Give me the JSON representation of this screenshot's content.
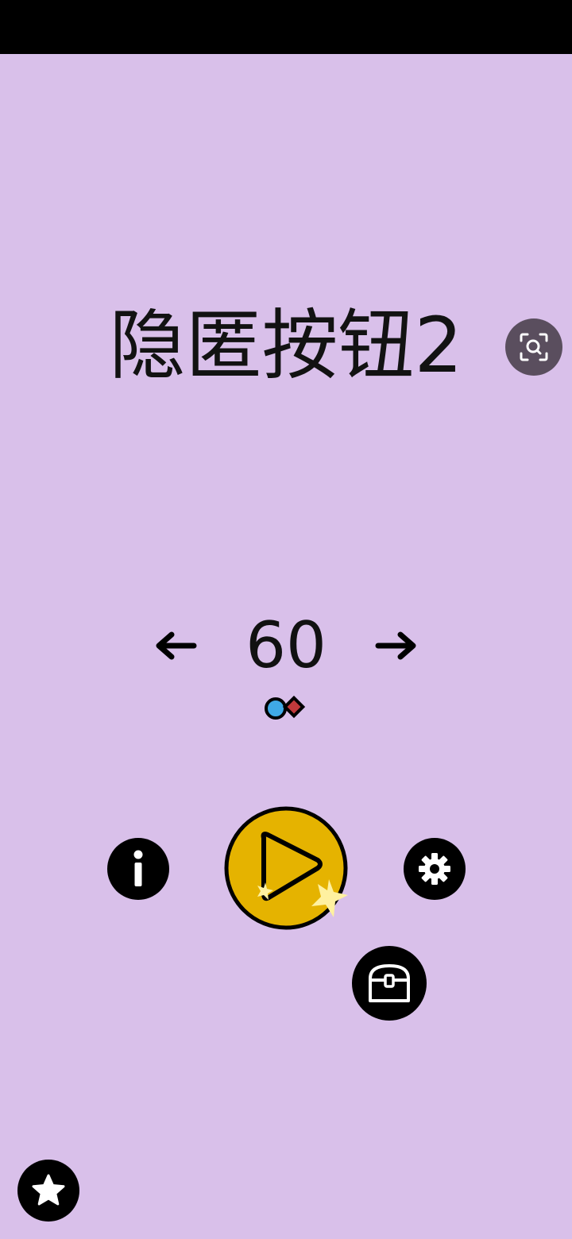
{
  "colors": {
    "background": "#D9C0EA",
    "status_bar": "#000000",
    "button_dark": "#000000",
    "play_fill": "#E5B300",
    "sparkle": "#FFF1A0",
    "screenshot_bg": "#5A4E5E",
    "dot_blue": "#3FA9E6",
    "diamond_red": "#C0393B"
  },
  "title": "隐匿按钮2",
  "level": {
    "number": "60",
    "prev_icon": "arrow-left-icon",
    "next_icon": "arrow-right-icon"
  },
  "buttons": {
    "info_icon": "info-icon",
    "play_icon": "play-icon",
    "settings_icon": "gear-icon",
    "chest_icon": "treasure-chest-icon",
    "star_icon": "star-icon",
    "screenshot_icon": "screenshot-search-icon"
  }
}
